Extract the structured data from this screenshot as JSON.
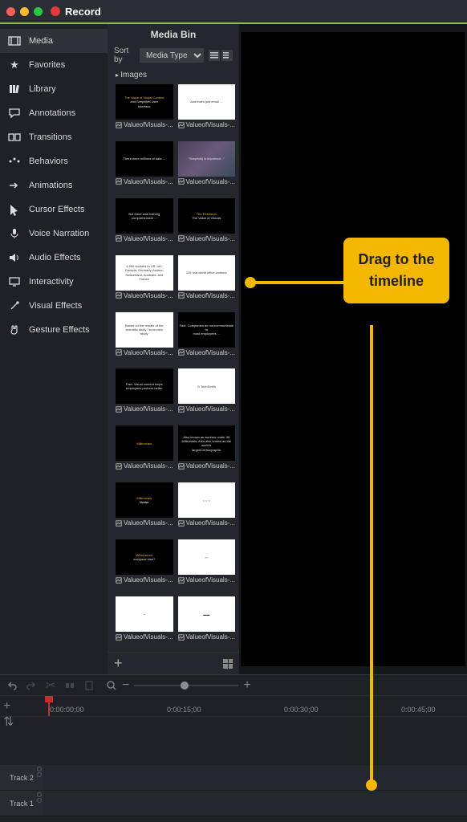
{
  "titlebar": {
    "record": "Record"
  },
  "sidebar": {
    "items": [
      {
        "label": "Media",
        "icon": "film"
      },
      {
        "label": "Favorites",
        "icon": "star"
      },
      {
        "label": "Library",
        "icon": "books"
      },
      {
        "label": "Annotations",
        "icon": "speech"
      },
      {
        "label": "Transitions",
        "icon": "swap"
      },
      {
        "label": "Behaviors",
        "icon": "dots"
      },
      {
        "label": "Animations",
        "icon": "arrow"
      },
      {
        "label": "Cursor Effects",
        "icon": "cursor"
      },
      {
        "label": "Voice Narration",
        "icon": "mic"
      },
      {
        "label": "Audio Effects",
        "icon": "speaker"
      },
      {
        "label": "Interactivity",
        "icon": "screen"
      },
      {
        "label": "Visual Effects",
        "icon": "wand"
      },
      {
        "label": "Gesture Effects",
        "icon": "hand"
      }
    ]
  },
  "mediabin": {
    "title": "Media Bin",
    "sort_label": "Sort by",
    "sort_value": "Media Type",
    "group": "Images",
    "thumb_label": "ValueofVisuals-...",
    "slides": [
      {
        "bg": "black",
        "line1": "The Value of Visual Content",
        "line2": "and Simplified User",
        "line3": "Interface",
        "cls": "yellow-text"
      },
      {
        "bg": "white",
        "line1": "And that's just email ..."
      },
      {
        "bg": "black",
        "line1": "There were millions of data ..."
      },
      {
        "bg": "blur",
        "line1": "\"Simplicity is important...\""
      },
      {
        "bg": "black",
        "line1": "But there was nothing",
        "line2": "comprehensive ..."
      },
      {
        "bg": "black",
        "line1": "The Research",
        "line2": "The Value of Visuals",
        "cls": "yellow-text"
      },
      {
        "bg": "white",
        "line1": "4,500 workers in US, UK,",
        "line2": "Canada, Germany, Austria,",
        "line3": "Switzerland, Australia, and",
        "line4": "France"
      },
      {
        "bg": "white",
        "line1": "125 real world office workers"
      },
      {
        "bg": "white",
        "line1": "Based on the results of the",
        "line2": "scientific study / economic",
        "line3": "study"
      },
      {
        "bg": "black",
        "line1": "Fact: Companies do not communicate to",
        "line2": "most employees ..."
      },
      {
        "bg": "black",
        "line1": "Fact: Visual content helps",
        "line2": "employees perform better"
      },
      {
        "bg": "white",
        "line1": "⊙ TechSmith"
      },
      {
        "bg": "black",
        "line1": "Millennials",
        "cls": "yellow-text"
      },
      {
        "bg": "black",
        "line1": "Also known as workers under 35",
        "line2": "Millennials: Also also known as the world's",
        "line3": "largest demographic"
      },
      {
        "bg": "black",
        "line1": "Millennials",
        "line2": "Matter",
        "cls": "yellow-text"
      },
      {
        "bg": "white",
        "line1": "○ ○ ○"
      },
      {
        "bg": "black",
        "line1": "What about",
        "line2": "everyone else?",
        "cls": "yellow-text"
      },
      {
        "bg": "white",
        "line1": "▫▫▫"
      },
      {
        "bg": "white",
        "line1": "◔"
      },
      {
        "bg": "white",
        "line1": "▬▬"
      }
    ]
  },
  "callout": {
    "text": "Drag to the timeline"
  },
  "timeline": {
    "ticks": [
      "0:00:00;00",
      "0:00:15;00",
      "0:00:30;00",
      "0:00:45;00"
    ],
    "tracks": [
      "Track 2",
      "Track 1"
    ]
  }
}
